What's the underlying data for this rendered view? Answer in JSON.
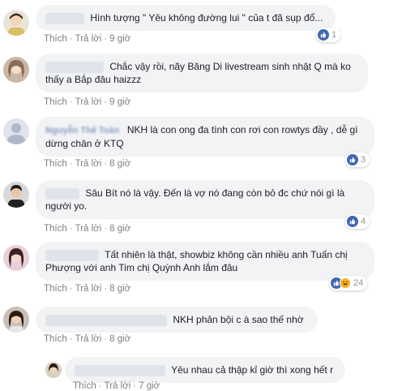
{
  "actions": {
    "like": "Thích",
    "reply": "Trả lời",
    "dot": "·"
  },
  "comments": [
    {
      "name": "",
      "text": "Hình tượng \" Yêu không đường lui \" của t đã sụp đổ...",
      "time": "9 giờ",
      "reactions": "1"
    },
    {
      "name": "",
      "text": "Chắc vậy rồi, nãy Băng Di livestream sinh nhật Q mà ko thấy a Bắp đâu haizzz",
      "time": "9 giờ",
      "reactions": ""
    },
    {
      "name": "Nguyễn Thế Toàn",
      "text": "NKH là con ong đa tình con rơi con rowtys đầy , dễ gì dừng chân ở KTQ",
      "time": "8 giờ",
      "reactions": "3"
    },
    {
      "name": "",
      "text": "Sâu Bít nó là vậy. Đến là vợ nó đang còn bỏ đc chứ nói gì là người yo.",
      "time": "8 giờ",
      "reactions": "4"
    },
    {
      "name": "",
      "text": "Tất nhiên là thật, showbiz không cần nhiều anh Tuấn chị Phượng với anh Tim chị Quỳnh Anh lắm đâu",
      "time": "8 giờ",
      "reactions": "24"
    },
    {
      "name": "",
      "text": "NKH phản bội c à sao thế nhờ",
      "time": "8 giờ",
      "reactions": ""
    },
    {
      "name": "",
      "text": "Yêu nhau cả thập kỉ giờ thì xong hết r",
      "time": "7 giờ",
      "reactions": ""
    }
  ],
  "colors": {
    "bubble": "#f2f3f5",
    "link": "#385898",
    "like": "#4267b2",
    "haha": "#f7b125",
    "meta": "#7f7f7f"
  }
}
